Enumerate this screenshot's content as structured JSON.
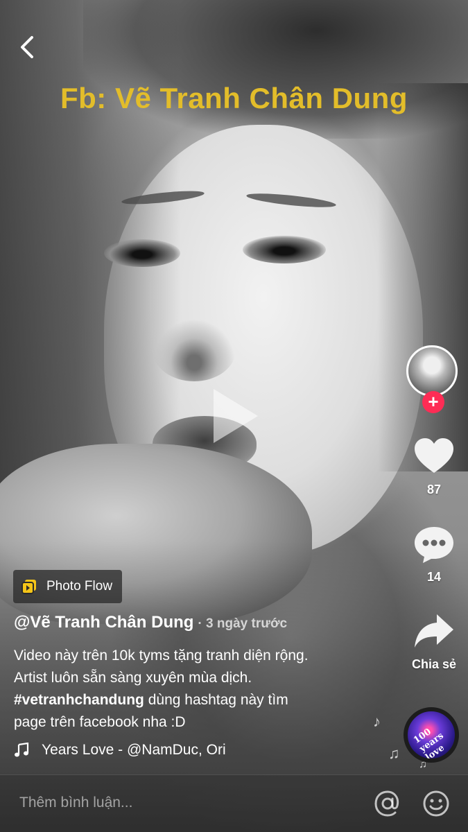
{
  "watermark": "Fb: Vẽ Tranh Chân Dung",
  "actions": {
    "likes": "87",
    "comments": "14",
    "share": "Chia sẻ"
  },
  "effect": {
    "label": "Photo Flow"
  },
  "post": {
    "username": "@Vẽ Tranh Chân Dung",
    "time": "· 3 ngày trước",
    "caption_line1": "Video này trên 10k tyms tặng tranh diện rộng.",
    "caption_line2": "Artist luôn sẵn sàng xuyên mùa dịch.",
    "hashtag": "#vetranhchandung",
    "caption_after_tag": " dùng hashtag này tìm",
    "caption_line4": "page trên facebook nha :D"
  },
  "music": {
    "title": "Years Love - @NamDuc, Ori"
  },
  "disc_text": "100 years love",
  "comment": {
    "placeholder": "Thêm bình luận..."
  },
  "colors": {
    "watermark": "#e3bd2a",
    "follow_accent": "#fe2c55",
    "effect_icon": "#f5c518"
  },
  "icons": {
    "back": "chevron-left-icon",
    "play": "play-icon",
    "like": "heart-icon",
    "comment": "comment-bubble-icon",
    "share": "share-arrow-icon",
    "music": "music-note-icon",
    "mention": "at-sign-icon",
    "emoji": "smiley-icon",
    "effect": "photo-flow-icon"
  }
}
